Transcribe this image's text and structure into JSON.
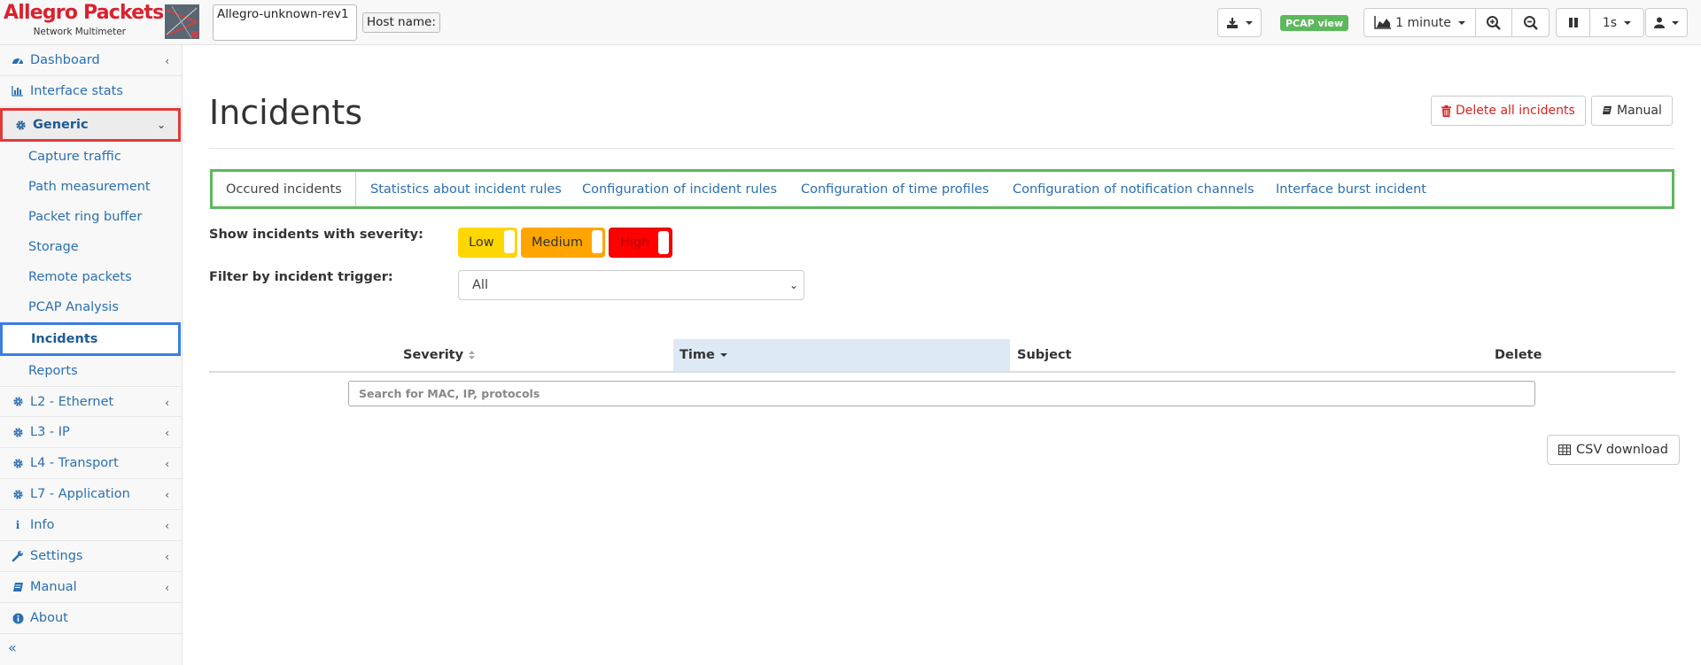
{
  "brand": {
    "name": "Allegro Packets",
    "subtitle": "Network Multimeter"
  },
  "colors": {
    "brand_red": "#d8222f",
    "link_blue": "#2a6fb0",
    "tab_highlight": "#5cb85c",
    "generic_highlight": "#e03a3a",
    "incidents_highlight": "#3a7fe0"
  },
  "header": {
    "device_name": "Allegro-unknown-rev1",
    "host_label": "Host name:",
    "pcap_badge": "PCAP view",
    "time_range": "1 minute",
    "interval": "1s"
  },
  "sidebar": {
    "items": [
      {
        "label": "Dashboard",
        "icon": "dashboard-icon"
      },
      {
        "label": "Interface stats",
        "icon": "bar-chart-icon"
      },
      {
        "label": "Generic",
        "icon": "gear-icon"
      },
      {
        "label": "L2 - Ethernet",
        "icon": "gear-icon"
      },
      {
        "label": "L3 - IP",
        "icon": "gear-icon"
      },
      {
        "label": "L4 - Transport",
        "icon": "gear-icon"
      },
      {
        "label": "L7 - Application",
        "icon": "gear-icon"
      },
      {
        "label": "Info",
        "icon": "info-icon"
      },
      {
        "label": "Settings",
        "icon": "wrench-icon"
      },
      {
        "label": "Manual",
        "icon": "book-icon"
      },
      {
        "label": "About",
        "icon": "info-circle-icon"
      }
    ],
    "generic_children": [
      "Capture traffic",
      "Path measurement",
      "Packet ring buffer",
      "Storage",
      "Remote packets",
      "PCAP Analysis",
      "Incidents",
      "Reports"
    ],
    "collapse_glyph": "«"
  },
  "main": {
    "title": "Incidents",
    "delete_all_label": "Delete all incidents",
    "manual_label": "Manual",
    "tabs": [
      "Occured incidents",
      "Statistics about incident rules",
      "Configuration of incident rules",
      "Configuration of time profiles",
      "Configuration of notification channels",
      "Interface burst incident"
    ],
    "severity_label": "Show incidents with severity:",
    "severity": [
      {
        "label": "Low",
        "color": "#ffd700",
        "enabled": true
      },
      {
        "label": "Medium",
        "color": "#ffa500",
        "enabled": true
      },
      {
        "label": "High",
        "color": "#ff0000",
        "enabled": true
      }
    ],
    "trigger_label": "Filter by incident trigger:",
    "trigger_value": "All",
    "table": {
      "columns": [
        "Severity",
        "Time",
        "Subject",
        "Delete"
      ],
      "search_placeholder": "Search for MAC, IP, protocols"
    },
    "csv_label": "CSV download"
  }
}
